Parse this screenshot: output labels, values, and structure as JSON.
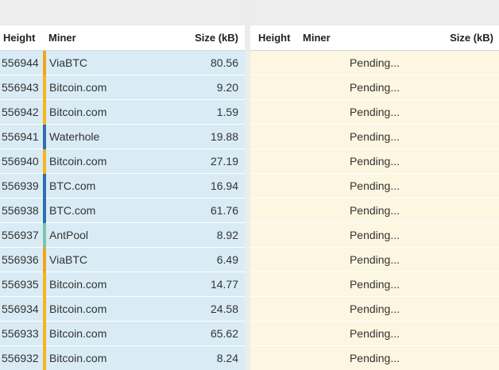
{
  "colors": {
    "viabtc": "#f7a21b",
    "bitcoin_com": "#f7b41b",
    "waterhole": "#2f6fb0",
    "btc_com": "#2f6fb0",
    "antpool": "#7cc6a9",
    "left_row_bg": "#d9ecf5",
    "right_row_bg": "#fdf6e0"
  },
  "left": {
    "headers": {
      "height": "Height",
      "miner": "Miner",
      "size": "Size (kB)"
    },
    "rows": [
      {
        "height": "556944",
        "miner": "ViaBTC",
        "size": "80.56",
        "color": "#f7a21b"
      },
      {
        "height": "556943",
        "miner": "Bitcoin.com",
        "size": "9.20",
        "color": "#f7b41b"
      },
      {
        "height": "556942",
        "miner": "Bitcoin.com",
        "size": "1.59",
        "color": "#f7b41b"
      },
      {
        "height": "556941",
        "miner": "Waterhole",
        "size": "19.88",
        "color": "#2f6fb0"
      },
      {
        "height": "556940",
        "miner": "Bitcoin.com",
        "size": "27.19",
        "color": "#f7b41b"
      },
      {
        "height": "556939",
        "miner": "BTC.com",
        "size": "16.94",
        "color": "#2f6fb0"
      },
      {
        "height": "556938",
        "miner": "BTC.com",
        "size": "61.76",
        "color": "#2f6fb0"
      },
      {
        "height": "556937",
        "miner": "AntPool",
        "size": "8.92",
        "color": "#7cc6a9"
      },
      {
        "height": "556936",
        "miner": "ViaBTC",
        "size": "6.49",
        "color": "#f7a21b"
      },
      {
        "height": "556935",
        "miner": "Bitcoin.com",
        "size": "14.77",
        "color": "#f7b41b"
      },
      {
        "height": "556934",
        "miner": "Bitcoin.com",
        "size": "24.58",
        "color": "#f7b41b"
      },
      {
        "height": "556933",
        "miner": "Bitcoin.com",
        "size": "65.62",
        "color": "#f7b41b"
      },
      {
        "height": "556932",
        "miner": "Bitcoin.com",
        "size": "8.24",
        "color": "#f7b41b"
      }
    ]
  },
  "right": {
    "headers": {
      "height": "Height",
      "miner": "Miner",
      "size": "Size (kB)"
    },
    "rows": [
      {
        "status": "Pending..."
      },
      {
        "status": "Pending..."
      },
      {
        "status": "Pending..."
      },
      {
        "status": "Pending..."
      },
      {
        "status": "Pending..."
      },
      {
        "status": "Pending..."
      },
      {
        "status": "Pending..."
      },
      {
        "status": "Pending..."
      },
      {
        "status": "Pending..."
      },
      {
        "status": "Pending..."
      },
      {
        "status": "Pending..."
      },
      {
        "status": "Pending..."
      },
      {
        "status": "Pending..."
      }
    ]
  }
}
